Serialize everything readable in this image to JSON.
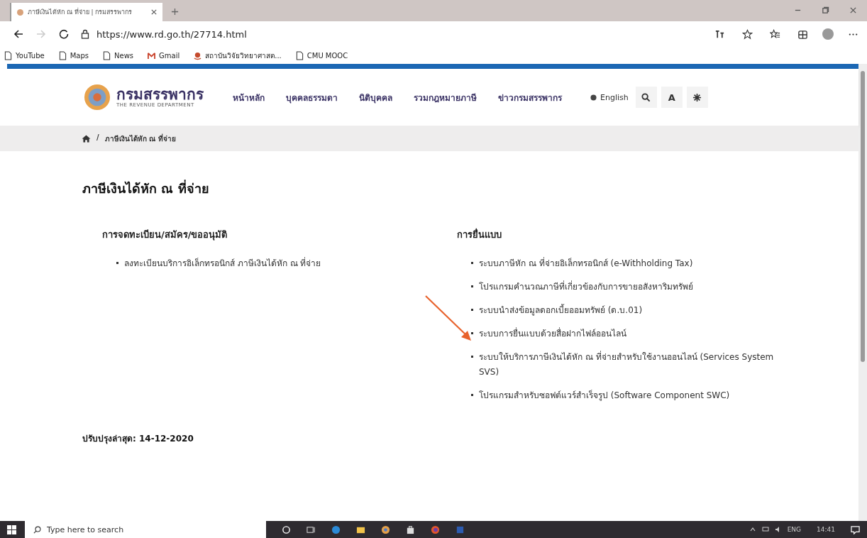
{
  "browser": {
    "tab_title": "ภาษีเงินได้หัก ณ ที่จ่าย | กรมสรรพากร",
    "url": "https://www.rd.go.th/27714.html",
    "bookmarks": [
      {
        "label": "YouTube",
        "kind": "page"
      },
      {
        "label": "Maps",
        "kind": "page"
      },
      {
        "label": "News",
        "kind": "page"
      },
      {
        "label": "Gmail",
        "kind": "mail"
      },
      {
        "label": "สถาบันวิจัยวิทยาศาสต...",
        "kind": "site"
      },
      {
        "label": "CMU MOOC",
        "kind": "page"
      }
    ]
  },
  "site": {
    "logo": {
      "name": "กรมสรรพากร",
      "subtitle": "THE REVENUE DEPARTMENT"
    },
    "nav": [
      "หน้าหลัก",
      "บุคคลธรรมดา",
      "นิติบุคคล",
      "รวมกฎหมายภาษี",
      "ข่าวกรมสรรพากร"
    ],
    "language": "English",
    "font_button": "A",
    "breadcrumb": {
      "separator": "/",
      "items": [
        "ภาษีเงินได้หัก ณ ที่จ่าย"
      ]
    },
    "page_title": "ภาษีเงินได้หัก ณ ที่จ่าย",
    "sections": [
      {
        "heading": "การจดทะเบียน/สมัคร/ขออนุมัติ",
        "items": [
          "ลงทะเบียนบริการอิเล็กทรอนิกส์ ภาษีเงินได้หัก ณ ที่จ่าย"
        ]
      },
      {
        "heading": "การยื่นแบบ",
        "items": [
          "ระบบภาษีหัก ณ ที่จ่ายอิเล็กทรอนิกส์ (e-Withholding Tax)",
          "โปรแกรมคำนวณภาษีที่เกี่ยวข้องกับการขายอสังหาริมทรัพย์",
          "ระบบนำส่งข้อมูลดอกเบี้ยออมทรัพย์ (ด.บ.01)",
          "ระบบการยื่นแบบด้วยสื่อฝากไฟล์ออนไลน์",
          "ระบบให้บริการภาษีเงินได้หัก ณ ที่จ่ายสำหรับใช้งานออนไลน์ (Services System SVS)",
          "โปรแกรมสำหรับซอฟต์แวร์สำเร็จรูป (Software Component SWC)"
        ]
      }
    ],
    "updated": "ปรับปรุงล่าสุด: 14-12-2020"
  },
  "taskbar": {
    "search_placeholder": "Type here to search",
    "language": "ENG",
    "time": "14:41"
  }
}
